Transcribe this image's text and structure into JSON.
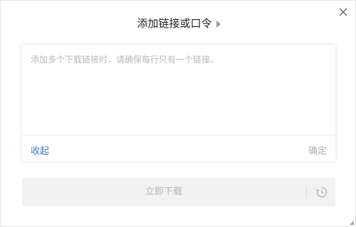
{
  "dialog": {
    "title": "添加链接或口令",
    "close_icon": "close-icon",
    "title_arrow_icon": "triangle-right-icon"
  },
  "input": {
    "value": "",
    "placeholder": "添加多个下载链接时，请确保每行只有一个链接。"
  },
  "actions": {
    "collapse_label": "收起",
    "confirm_label": "确定",
    "download_now_label": "立即下载",
    "schedule_icon": "clock-icon"
  },
  "colors": {
    "link_blue": "#3a78d8",
    "disabled_text": "#b5b5b5",
    "bar_bg": "#f2f2f2"
  }
}
